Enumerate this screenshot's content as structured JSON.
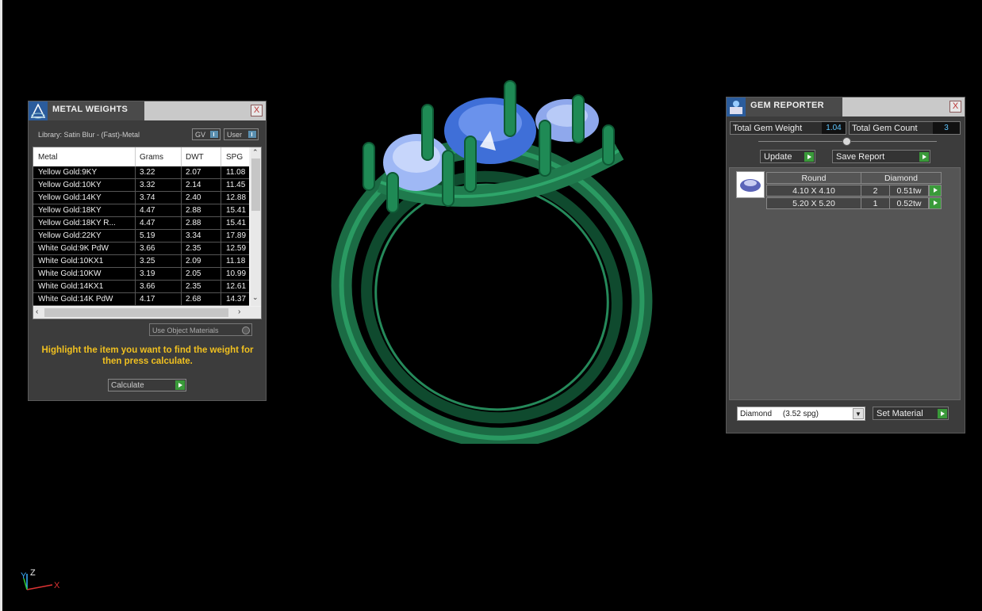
{
  "metal_weights": {
    "title": "METAL WEIGHTS",
    "close": "X",
    "library_label": "Library: Satin Blur - (Fast)-Metal",
    "toggles": [
      "GV",
      "User"
    ],
    "columns": [
      "Metal",
      "Grams",
      "DWT",
      "SPG"
    ],
    "rows": [
      [
        "Yellow Gold:9KY",
        "3.22",
        "2.07",
        "11.08"
      ],
      [
        "Yellow Gold:10KY",
        "3.32",
        "2.14",
        "11.45"
      ],
      [
        "Yellow Gold:14KY",
        "3.74",
        "2.40",
        "12.88"
      ],
      [
        "Yellow Gold:18KY",
        "4.47",
        "2.88",
        "15.41"
      ],
      [
        "Yellow Gold:18KY R...",
        "4.47",
        "2.88",
        "15.41"
      ],
      [
        "Yellow Gold:22KY",
        "5.19",
        "3.34",
        "17.89"
      ],
      [
        "White Gold:9K PdW",
        "3.66",
        "2.35",
        "12.59"
      ],
      [
        "White Gold:10KX1",
        "3.25",
        "2.09",
        "11.18"
      ],
      [
        "White Gold:10KW",
        "3.19",
        "2.05",
        "10.99"
      ],
      [
        "White Gold:14KX1",
        "3.66",
        "2.35",
        "12.61"
      ],
      [
        "White Gold:14K PdW",
        "4.17",
        "2.68",
        "14.37"
      ]
    ],
    "use_object_materials": "Use Object Materials",
    "hint": "Highlight the item you want to find the weight for then press calculate.",
    "calculate": "Calculate"
  },
  "gem_reporter": {
    "title": "GEM REPORTER",
    "close": "X",
    "total_weight_label": "Total Gem Weight",
    "total_weight": "1.04",
    "total_count_label": "Total Gem Count",
    "total_count": "3",
    "update": "Update",
    "save_report": "Save Report",
    "table": {
      "shape": "Round",
      "material": "Diamond",
      "rows": [
        {
          "size": "4.10 X 4.10",
          "count": "2",
          "weight": "0.51tw"
        },
        {
          "size": "5.20 X 5.20",
          "count": "1",
          "weight": "0.52tw"
        }
      ]
    },
    "material_select": "Diamond     (3.52 spg)",
    "set_material": "Set Material"
  },
  "axis": {
    "y": "Y",
    "z": "Z",
    "x": "X"
  },
  "colors": {
    "ring_green": "#1f7a4d",
    "gem_blue": "#3f6fd8",
    "gem_light": "#9fb8f5",
    "hint_yellow": "#f0c020",
    "value_blue": "#5fc7ff"
  }
}
